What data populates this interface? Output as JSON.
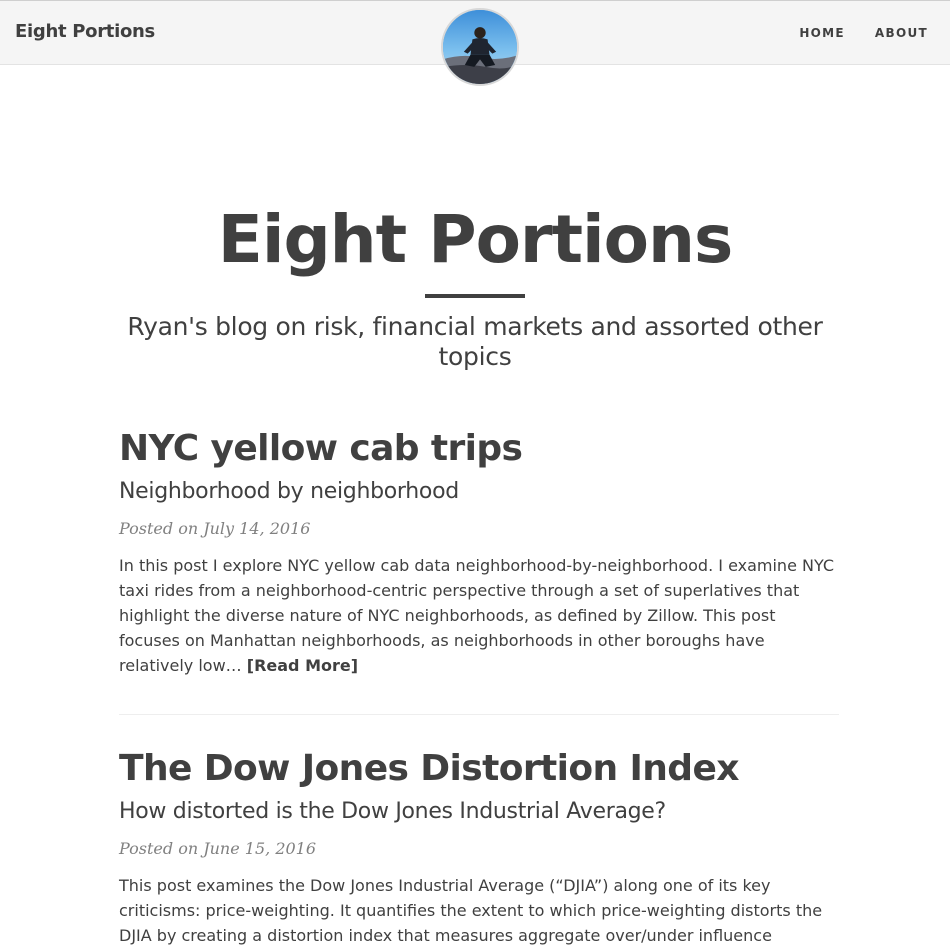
{
  "nav": {
    "brand": "Eight Portions",
    "links": [
      "HOME",
      "ABOUT"
    ]
  },
  "header": {
    "title": "Eight Portions",
    "subtitle": "Ryan's blog on risk, financial markets and assorted other topics"
  },
  "posts": [
    {
      "title": "NYC yellow cab trips",
      "subtitle": "Neighborhood by neighborhood",
      "meta": "Posted on July 14, 2016",
      "excerpt": "In this post I explore NYC yellow cab data neighborhood-by-neighborhood. I examine NYC taxi rides from a neighborhood-centric perspective through a set of superlatives that highlight the diverse nature of NYC neighborhoods, as defined by Zillow. This post focuses on Manhattan neighborhoods, as neighborhoods in other boroughs have relatively low…",
      "read_more": "[Read More]"
    },
    {
      "title": "The Dow Jones Distortion Index",
      "subtitle": "How distorted is the Dow Jones Industrial Average?",
      "meta": "Posted on June 15, 2016",
      "excerpt": "This post examines the Dow Jones Industrial Average (“DJIA”) along one of its key criticisms: price-weighting. It quantifies the extent to which price-weighting distorts the DJIA by creating a distortion index that measures aggregate over/under influence"
    }
  ],
  "colors": {
    "text": "#404040",
    "meta": "#808080",
    "navbar_bg": "#f5f5f5"
  }
}
